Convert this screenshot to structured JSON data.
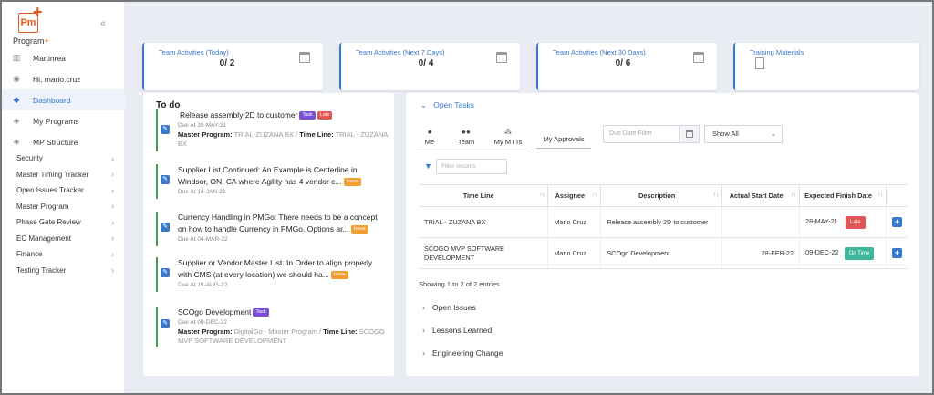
{
  "brand": {
    "logo_letters": "Pm",
    "name": "Program",
    "name_plus": "+"
  },
  "sidebar": {
    "top": [
      {
        "icon": "building-icon",
        "label": "Martinrea"
      },
      {
        "icon": "user-icon",
        "label": "Hi, mario.cruz"
      },
      {
        "icon": "dashboard-icon",
        "label": "Dashboard",
        "active": true
      },
      {
        "icon": "layers-icon",
        "label": "My Programs"
      },
      {
        "icon": "layers-icon",
        "label": "MP Structure"
      }
    ],
    "menu": [
      "Security",
      "Master Timing Tracker",
      "Open Issues Tracker",
      "Master Program",
      "Phase Gate Review",
      "EC Management",
      "Finance",
      "Testing Tracker"
    ]
  },
  "cards": [
    {
      "title": "Team Activities (Today)",
      "value": "0/ 2"
    },
    {
      "title": "Team Activities (Next 7 Days)",
      "value": "0/ 4"
    },
    {
      "title": "Team Activities (Next 30 Days)",
      "value": "0/ 6"
    },
    {
      "title": "Training Materials",
      "value": ""
    }
  ],
  "todo": {
    "title": "To do",
    "tasks": [
      {
        "title": "Release assembly 2D to customer",
        "badges": [
          "Task",
          "Late"
        ],
        "due": "Due At 28-MAY-21",
        "program_label": "Master Program:",
        "program": "TRIAL-ZUZANA BX",
        "sep": "/",
        "timeline_label": "Time Line:",
        "timeline": "TRIAL - ZUZANA BX"
      },
      {
        "title": "Supplier List Continued: An Example is Centerline in Windsor, ON, CA where Agility has 4 vendor c...",
        "badges": [
          "Issue"
        ],
        "due": "Due At 14-JAN-22"
      },
      {
        "title": "Currency Handling in PMGo: There needs to be a concept on how to handle Currency in PMGo. Options ar...",
        "badges": [
          "Issue"
        ],
        "due": "Due At 04-MAR-22"
      },
      {
        "title": "Supplier or Vendor Master List. In Order to align properly with CMS (at every location) we should ha...",
        "badges": [
          "Issue"
        ],
        "due": "Due At 19-AUG-22"
      },
      {
        "title": "SCOgo Development",
        "badges": [
          "Task"
        ],
        "due": "Due At 09-DEC-22",
        "program_label": "Master Program:",
        "program": "DigitalGo - Master Program",
        "sep": "/",
        "timeline_label": "Time Line:",
        "timeline": "SCOGO MVP SOFTWARE DEVELOPMENT"
      }
    ]
  },
  "open_tasks": {
    "title": "Open Tasks",
    "tabs": [
      "Me",
      "Team",
      "My MTTs"
    ],
    "my_approvals": "My Approvals",
    "date_filter_placeholder": "Due Date Filter",
    "show_all": "Show All",
    "filter_placeholder": "Filter records",
    "columns": [
      "Time Line",
      "Assignee",
      "Description",
      "Actual Start Date",
      "Expected Finish Date"
    ],
    "rows": [
      {
        "timeline": "TRIAL - ZUZANA BX",
        "assignee": "Mario Cruz",
        "description": "Release assembly 2D to customer",
        "start": "",
        "finish": "28-MAY-21",
        "status": "Late"
      },
      {
        "timeline": "SCOGO MVP SOFTWARE DEVELOPMENT",
        "assignee": "Mario Cruz",
        "description": "SCOgo Development",
        "start": "28-FEB-22",
        "finish": "09-DEC-22",
        "status": "On Time"
      }
    ],
    "entries": "Showing 1 to 2 of 2 entries"
  },
  "accordions": [
    "Open Issues",
    "Lessons Learned",
    "Engineering Change"
  ],
  "colors": {
    "accent": "#3a79c8",
    "brand": "#e4571a",
    "late": "#e25555",
    "on_time": "#3fb59b",
    "task": "#7a4fd6",
    "issue": "#f0a030"
  }
}
